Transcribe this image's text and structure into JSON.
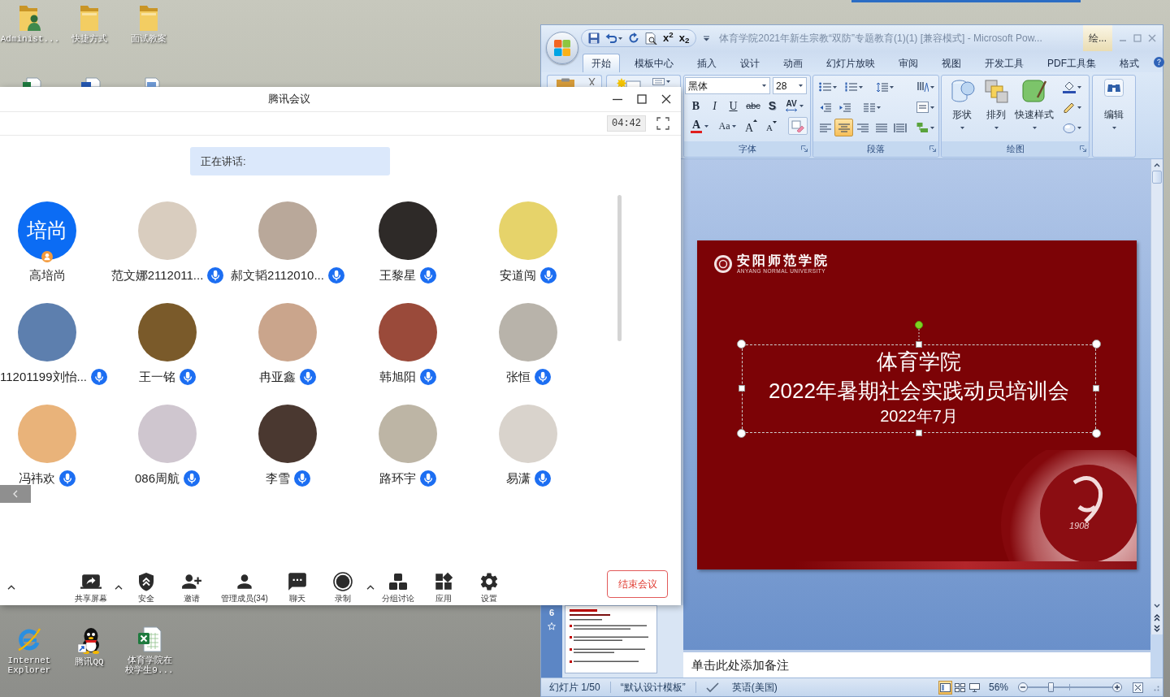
{
  "desktop": {
    "top_icons": [
      {
        "label": "Administ...",
        "kind": "user-folder"
      },
      {
        "label": "快捷方式",
        "kind": "folder"
      },
      {
        "label": "面试教案",
        "kind": "folder"
      }
    ],
    "partial_icons": [
      {
        "kind": "spreadsheet"
      },
      {
        "kind": "document"
      },
      {
        "kind": "presentation"
      }
    ],
    "bottom_icons": [
      {
        "label": "Internet Explorer",
        "kind": "browser"
      },
      {
        "label": "腾讯QQ",
        "kind": "penguin"
      },
      {
        "label": "体育学院在校学生9...",
        "kind": "spreadsheet"
      }
    ]
  },
  "meeting": {
    "title": "腾讯会议",
    "timer": "04:42",
    "speaking_label": "正在讲话:",
    "participants": [
      {
        "name": "高培尚",
        "kind": "initials",
        "initials": "培尚",
        "host": true,
        "mic": false
      },
      {
        "name": "范文娜2112011...",
        "kind": "photo",
        "host": false,
        "mic": true
      },
      {
        "name": "郝文韬2112010...",
        "kind": "photo",
        "host": false,
        "mic": true
      },
      {
        "name": "王黎星",
        "kind": "photo",
        "host": false,
        "mic": true
      },
      {
        "name": "安道闯",
        "kind": "photo",
        "host": false,
        "mic": true
      },
      {
        "name": "11201199刘怡...",
        "kind": "photo",
        "host": false,
        "mic": true
      },
      {
        "name": "王一铭",
        "kind": "photo",
        "host": false,
        "mic": true
      },
      {
        "name": "冉亚鑫",
        "kind": "photo",
        "host": false,
        "mic": true
      },
      {
        "name": "韩旭阳",
        "kind": "photo",
        "host": false,
        "mic": true
      },
      {
        "name": "张恒",
        "kind": "photo",
        "host": false,
        "mic": true
      },
      {
        "name": "冯祎欢",
        "kind": "photo",
        "host": false,
        "mic": true
      },
      {
        "name": "086周航",
        "kind": "photo",
        "host": false,
        "mic": true
      },
      {
        "name": "李雪",
        "kind": "photo",
        "host": false,
        "mic": true
      },
      {
        "name": "路环宇",
        "kind": "photo",
        "host": false,
        "mic": true
      },
      {
        "name": "易潇",
        "kind": "photo",
        "host": false,
        "mic": true
      }
    ],
    "toolbar": [
      {
        "kind": "offscreen",
        "caret": true
      },
      {
        "kind": "share",
        "label": "共享屏幕",
        "caret": true
      },
      {
        "kind": "security",
        "label": "安全",
        "caret": false
      },
      {
        "kind": "invite",
        "label": "邀请",
        "caret": false
      },
      {
        "kind": "members",
        "label": "管理成员(34)",
        "caret": false
      },
      {
        "kind": "chat",
        "label": "聊天",
        "caret": false
      },
      {
        "kind": "record",
        "label": "录制",
        "caret": true
      },
      {
        "kind": "breakout",
        "label": "分组讨论",
        "caret": false
      },
      {
        "kind": "apps",
        "label": "应用",
        "caret": false
      },
      {
        "kind": "settings",
        "label": "设置",
        "caret": false
      }
    ],
    "end_button": "结束会议"
  },
  "powerpoint": {
    "quick_access": [
      {
        "kind": "save"
      },
      {
        "kind": "undo"
      },
      {
        "kind": "redo"
      },
      {
        "kind": "preview"
      },
      {
        "kind": "superscript",
        "label": "x$^{2}$"
      },
      {
        "kind": "subscript",
        "label": "x$_{2}$"
      }
    ],
    "title": "体育学院2021年新生宗教“双防”专题教育(1)(1) [兼容模式] - Microsoft Pow...",
    "tool_header": "绘...",
    "tabs": [
      {
        "label": "开始",
        "selected": true
      },
      {
        "label": "模板中心",
        "selected": false
      },
      {
        "label": "插入",
        "selected": false
      },
      {
        "label": "设计",
        "selected": false
      },
      {
        "label": "动画",
        "selected": false
      },
      {
        "label": "幻灯片放映",
        "selected": false
      },
      {
        "label": "审阅",
        "selected": false
      },
      {
        "label": "视图",
        "selected": false
      },
      {
        "label": "开发工具",
        "selected": false
      },
      {
        "label": "PDF工具集",
        "selected": false
      },
      {
        "label": "格式",
        "selected": false
      }
    ],
    "font": {
      "name": "黑体",
      "size": "28"
    },
    "font_buttons": [
      {
        "kind": "bold",
        "label": "B"
      },
      {
        "kind": "italic",
        "label": "I"
      },
      {
        "kind": "underline",
        "label": "U"
      },
      {
        "kind": "strike",
        "label": "abc"
      },
      {
        "kind": "shadow",
        "label": "S"
      },
      {
        "kind": "spacing",
        "label": "AV"
      }
    ],
    "font_buttons_2": [
      {
        "kind": "color",
        "label": "A"
      },
      {
        "kind": "case",
        "label": "Aa"
      },
      {
        "kind": "grow",
        "label": "A"
      },
      {
        "kind": "shrink",
        "label": "A"
      },
      {
        "kind": "clear"
      }
    ],
    "paragraph_align": [
      {
        "kind": "left",
        "selected": false
      },
      {
        "kind": "center",
        "selected": true
      },
      {
        "kind": "right",
        "selected": false
      },
      {
        "kind": "justify",
        "selected": false
      },
      {
        "kind": "distributed",
        "selected": false
      }
    ],
    "groups": [
      {
        "label": "字体"
      },
      {
        "label": "段落"
      },
      {
        "label": "绘图"
      }
    ],
    "drawing_buttons": [
      {
        "kind": "shapes",
        "label": "形状"
      },
      {
        "kind": "arrange",
        "label": "排列"
      },
      {
        "kind": "styles",
        "label": "快速样式"
      }
    ],
    "edit_button": "编辑",
    "thumbnail": {
      "number": "6"
    },
    "slide": {
      "logo_title": "安阳师范学院",
      "logo_subtitle": "ANYANG NORMAL UNIVERSITY",
      "lines": [
        "体育学院",
        "2022年暑期社会实践动员培训会",
        "2022年7月"
      ],
      "seal_year": "1908"
    },
    "notes": {
      "placeholder": "单击此处添加备注"
    },
    "status_bar": {
      "slide": "幻灯片 1/50",
      "theme": "“默认设计模板”",
      "language": "英语(美国)",
      "views": [
        {
          "kind": "normal",
          "selected": true
        },
        {
          "kind": "sorter",
          "selected": false
        },
        {
          "kind": "show",
          "selected": false
        }
      ],
      "zoom": "56%",
      "zoom_slider": {
        "level": 0.27
      }
    }
  }
}
